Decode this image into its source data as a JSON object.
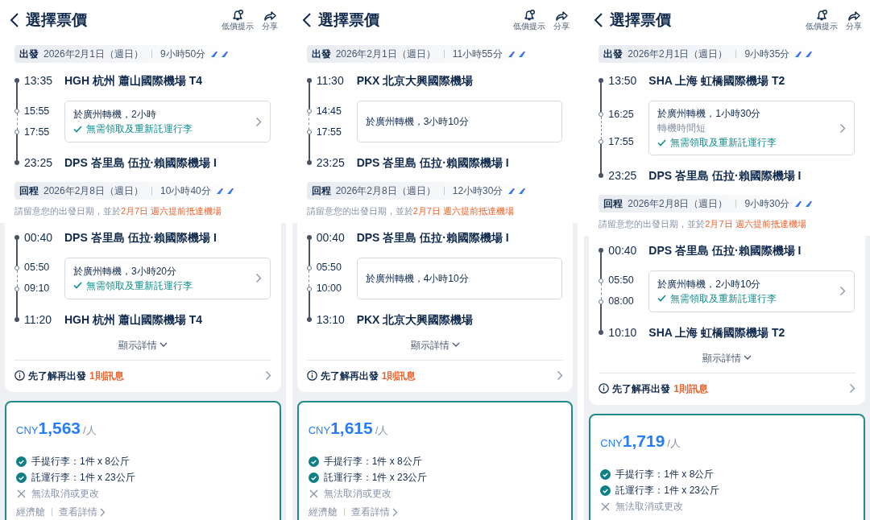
{
  "screens": [
    {
      "header": {
        "title": "選擇票價",
        "actions": [
          {
            "kind": "alert",
            "label": "低價提示"
          },
          {
            "kind": "share",
            "label": "分享"
          }
        ]
      },
      "legs": [
        {
          "label": "出發",
          "date": "2026年2月1日（週日）",
          "duration": "9小時50分",
          "depart": {
            "time": "13:35",
            "airport": "HGH 杭州 蕭山國際機場 T4"
          },
          "layover": {
            "arrive_time": "15:55",
            "depart_time": "17:55",
            "text": "於廣州轉機，2小時",
            "baggage_note": "無需領取及重新託運行李"
          },
          "arrive": {
            "time": "23:25",
            "airport": "DPS 峇里島 伍拉·賴國際機場 I"
          }
        },
        {
          "label": "回程",
          "date": "2026年2月8日（週日）",
          "duration": "10小時40分",
          "note": "請留意您的出發日期，並於",
          "note_highlight": "2月7日 週六提前抵達機場",
          "depart": {
            "time": "00:40",
            "airport": "DPS 峇里島 伍拉·賴國際機場 I"
          },
          "layover": {
            "arrive_time": "05:50",
            "depart_time": "09:10",
            "text": "於廣州轉機，3小時20分",
            "baggage_note": "無需領取及重新託運行李"
          },
          "arrive": {
            "time": "11:20",
            "airport": "HGH 杭州 蕭山國際機場 T4"
          }
        }
      ],
      "details_toggle": "顯示詳情",
      "info": {
        "text": "先了解再出發",
        "highlight": "1則訊息"
      },
      "fare": {
        "currency": "CNY",
        "amount": "1,563",
        "unit": "/人",
        "features": [
          {
            "kind": "included",
            "text": "手提行李：1件 x 8公斤"
          },
          {
            "kind": "included",
            "text": "託運行李：1件 x 23公斤"
          },
          {
            "kind": "excluded",
            "text": "無法取消或更改"
          }
        ],
        "cabin": "經濟艙",
        "details_link": "查看詳情"
      }
    },
    {
      "header": {
        "title": "選擇票價",
        "actions": [
          {
            "kind": "alert",
            "label": "低價提示"
          },
          {
            "kind": "share",
            "label": "分享"
          }
        ]
      },
      "legs": [
        {
          "label": "出發",
          "date": "2026年2月1日（週日）",
          "duration": "11小時55分",
          "depart": {
            "time": "11:30",
            "airport": "PKX 北京大興國際機場"
          },
          "layover": {
            "arrive_time": "14:45",
            "depart_time": "17:55",
            "text": "於廣州轉機，3小時10分"
          },
          "arrive": {
            "time": "23:25",
            "airport": "DPS 峇里島 伍拉·賴國際機場 I"
          }
        },
        {
          "label": "回程",
          "date": "2026年2月8日（週日）",
          "duration": "12小時30分",
          "note": "請留意您的出發日期，並於",
          "note_highlight": "2月7日 週六提前抵達機場",
          "depart": {
            "time": "00:40",
            "airport": "DPS 峇里島 伍拉·賴國際機場 I"
          },
          "layover": {
            "arrive_time": "05:50",
            "depart_time": "10:00",
            "text": "於廣州轉機，4小時10分"
          },
          "arrive": {
            "time": "13:10",
            "airport": "PKX 北京大興國際機場"
          }
        }
      ],
      "details_toggle": "顯示詳情",
      "info": {
        "text": "先了解再出發",
        "highlight": "1則訊息"
      },
      "fare": {
        "currency": "CNY",
        "amount": "1,615",
        "unit": "/人",
        "features": [
          {
            "kind": "included",
            "text": "手提行李：1件 x 8公斤"
          },
          {
            "kind": "included",
            "text": "託運行李：1件 x 23公斤"
          },
          {
            "kind": "excluded",
            "text": "無法取消或更改"
          }
        ],
        "cabin": "經濟艙",
        "details_link": "查看詳情"
      }
    },
    {
      "header": {
        "title": "選擇票價",
        "actions": [
          {
            "kind": "alert",
            "label": "低價提示"
          },
          {
            "kind": "share",
            "label": "分享"
          }
        ]
      },
      "legs": [
        {
          "label": "出發",
          "date": "2026年2月1日（週日）",
          "duration": "9小時35分",
          "depart": {
            "time": "13:50",
            "airport": "SHA 上海 虹橋國際機場 T2"
          },
          "layover": {
            "arrive_time": "16:25",
            "depart_time": "17:55",
            "text": "於廣州轉機，1小時30分",
            "warning": "轉機時間短",
            "baggage_note": "無需領取及重新託運行李"
          },
          "arrive": {
            "time": "23:25",
            "airport": "DPS 峇里島 伍拉·賴國際機場 I"
          }
        },
        {
          "label": "回程",
          "date": "2026年2月8日（週日）",
          "duration": "9小時30分",
          "note": "請留意您的出發日期，並於",
          "note_highlight": "2月7日 週六提前抵達機場",
          "depart": {
            "time": "00:40",
            "airport": "DPS 峇里島 伍拉·賴國際機場 I"
          },
          "layover": {
            "arrive_time": "05:50",
            "depart_time": "08:00",
            "text": "於廣州轉機，2小時10分",
            "baggage_note": "無需領取及重新託運行李"
          },
          "arrive": {
            "time": "10:10",
            "airport": "SHA 上海 虹橋國際機場 T2"
          }
        }
      ],
      "details_toggle": "顯示詳情",
      "info": {
        "text": "先了解再出發",
        "highlight": "1則訊息"
      },
      "fare": {
        "currency": "CNY",
        "amount": "1,719",
        "unit": "/人",
        "features": [
          {
            "kind": "included",
            "text": "手提行李：1件 x 8公斤"
          },
          {
            "kind": "included",
            "text": "託運行李：1件 x 23公斤"
          },
          {
            "kind": "excluded",
            "text": "無法取消或更改"
          }
        ]
      }
    }
  ]
}
